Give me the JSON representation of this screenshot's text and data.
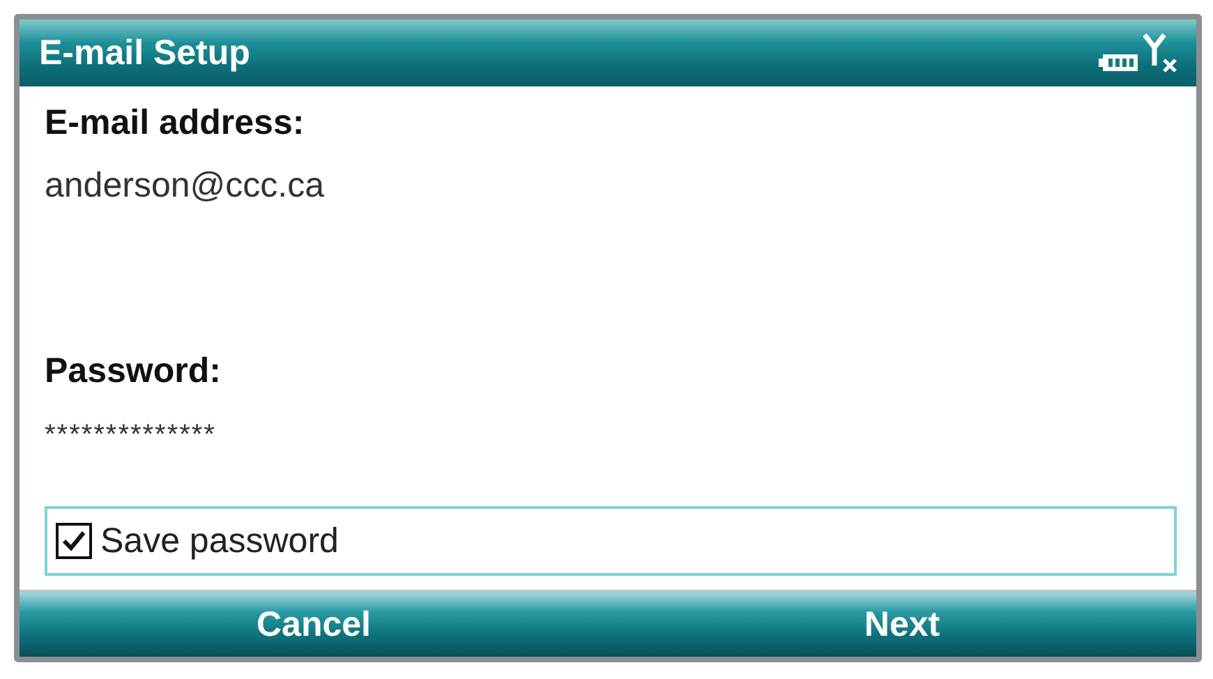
{
  "window": {
    "title": "E-mail Setup"
  },
  "fields": [
    {
      "label": "E-mail address:",
      "value": "anderson@ccc.ca"
    },
    {
      "label": "Password:",
      "value": "**************"
    }
  ],
  "save_password": {
    "label": "Save password",
    "checked": true
  },
  "softkeys": [
    "Cancel",
    "Next"
  ]
}
